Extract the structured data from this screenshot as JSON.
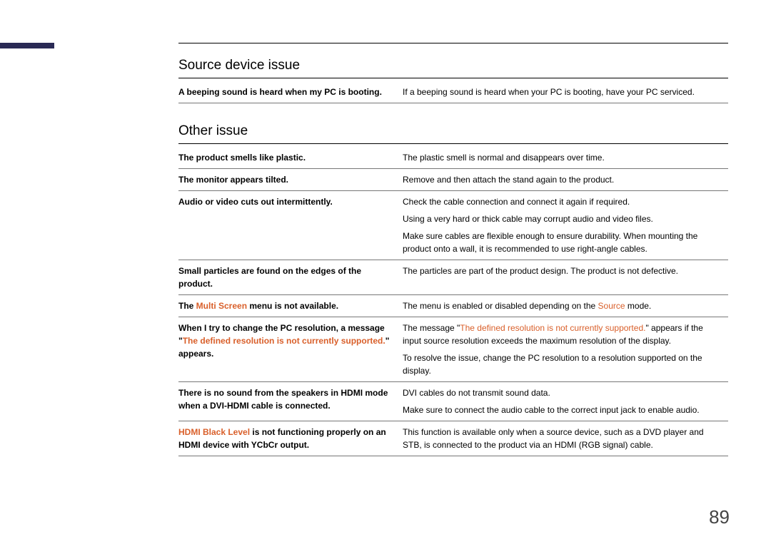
{
  "page_number": "89",
  "section1": {
    "title": "Source device issue",
    "rows": [
      {
        "issue_parts": [
          {
            "t": "A beeping sound is heard when my PC is booting."
          }
        ],
        "answer_parts": [
          {
            "t": "If a beeping sound is heard when your PC is booting, have your PC serviced."
          }
        ]
      }
    ]
  },
  "section2": {
    "title": "Other issue",
    "rows": [
      {
        "issue_parts": [
          {
            "t": "The product smells like plastic."
          }
        ],
        "answer_parts": [
          {
            "t": "The plastic smell is normal and disappears over time."
          }
        ]
      },
      {
        "issue_parts": [
          {
            "t": "The monitor appears tilted."
          }
        ],
        "answer_parts": [
          {
            "t": "Remove and then attach the stand again to the product."
          }
        ]
      },
      {
        "issue_parts": [
          {
            "t": "Audio or video cuts out intermittently."
          }
        ],
        "answer_paras": [
          [
            {
              "t": "Check the cable connection and connect it again if required."
            }
          ],
          [
            {
              "t": "Using a very hard or thick cable may corrupt audio and video files."
            }
          ],
          [
            {
              "t": "Make sure cables are flexible enough to ensure durability. When mounting the product onto a wall, it is recommended to use right-angle cables."
            }
          ]
        ]
      },
      {
        "issue_parts": [
          {
            "t": "Small particles are found on the edges of the product."
          }
        ],
        "answer_parts": [
          {
            "t": "The particles are part of the product design. The product is not defective."
          }
        ]
      },
      {
        "issue_parts": [
          {
            "t": "The "
          },
          {
            "t": "Multi Screen",
            "hl": true
          },
          {
            "t": " menu is not available."
          }
        ],
        "answer_parts": [
          {
            "t": "The menu is enabled or disabled depending on the "
          },
          {
            "t": "Source",
            "hl": true
          },
          {
            "t": " mode."
          }
        ]
      },
      {
        "issue_parts": [
          {
            "t": "When I try to change the PC resolution, a message \""
          },
          {
            "t": "The defined resolution is not currently supported.",
            "hl": true
          },
          {
            "t": "\" appears."
          }
        ],
        "answer_paras": [
          [
            {
              "t": "The message \""
            },
            {
              "t": "The defined resolution is not currently supported.",
              "hl": true
            },
            {
              "t": "\" appears if the input source resolution exceeds the maximum resolution of the display."
            }
          ],
          [
            {
              "t": "To resolve the issue, change the PC resolution to a resolution supported on the display."
            }
          ]
        ]
      },
      {
        "issue_parts": [
          {
            "t": "There is no sound from the speakers in HDMI mode when a DVI-HDMI cable is connected."
          }
        ],
        "answer_paras": [
          [
            {
              "t": "DVI cables do not transmit sound data."
            }
          ],
          [
            {
              "t": "Make sure to connect the audio cable to the correct input jack to enable audio."
            }
          ]
        ]
      },
      {
        "issue_parts": [
          {
            "t": "HDMI Black Level",
            "hl": true
          },
          {
            "t": " is not functioning properly on an HDMI device with YCbCr output."
          }
        ],
        "answer_parts": [
          {
            "t": "This function is available only when a source device, such as a DVD player and STB, is connected to the product via an HDMI (RGB signal) cable."
          }
        ]
      }
    ]
  }
}
